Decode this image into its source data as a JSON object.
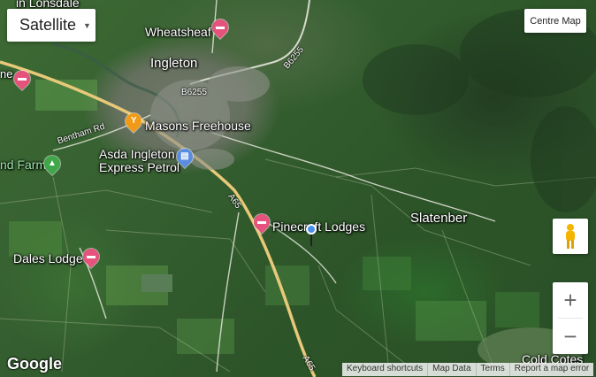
{
  "map_type": {
    "selected": "Satellite"
  },
  "controls": {
    "centre_map": "Centre Map",
    "zoom_in": "+",
    "zoom_out": "−"
  },
  "places": {
    "in_lonsdale": "in Lonsdale",
    "wheatsheaf": "Wheatsheaf",
    "ingleton": "Ingleton",
    "masons": "Masons Freehouse",
    "asda_line1": "Asda Ingleton",
    "asda_line2": "Express Petrol",
    "farm": "nd Farm",
    "pinecroft": "Pinecroft Lodges",
    "slatenber": "Slatenber",
    "dales_lodge": "Dales Lodge",
    "cold_cotes": "Cold Cotes",
    "left_edge": "ne"
  },
  "roads": {
    "b6255_a": "B6255",
    "b6255_b": "B6255",
    "bentham_rd": "Bentham Rd",
    "a65_a": "A65",
    "a65_b": "A65"
  },
  "branding": {
    "logo": "Google"
  },
  "attribution": {
    "keyboard": "Keyboard shortcuts",
    "map_data": "Map Data",
    "terms": "Terms",
    "report": "Report a map error"
  },
  "icons": {
    "hotel": "hotel-icon",
    "pub": "cocktail-icon",
    "fuel": "fuel-icon",
    "camp": "campsite-icon",
    "pegman": "pegman-icon"
  },
  "colors": {
    "hotel_pin": "#e5527c",
    "pub_pin": "#f29a15",
    "fuel_pin": "#5a8de1",
    "camp_pin": "#3fa64a",
    "road": "#e8c97a"
  }
}
